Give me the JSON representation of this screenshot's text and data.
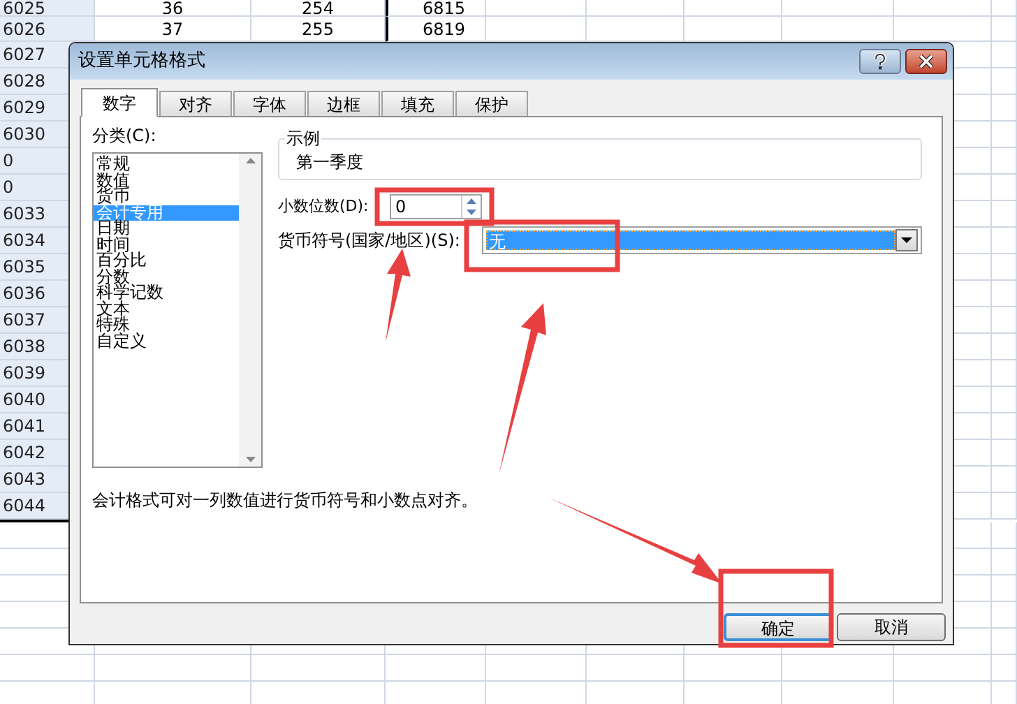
{
  "sheet": {
    "rows": [
      {
        "header": "6025",
        "cells": [
          "36",
          "254",
          "6815"
        ]
      },
      {
        "header": "6026",
        "cells": [
          "37",
          "255",
          "6819"
        ]
      },
      {
        "header": "6027"
      },
      {
        "header": "6028"
      },
      {
        "header": "6029"
      },
      {
        "header": "6030"
      },
      {
        "header": "0"
      },
      {
        "header": "0"
      },
      {
        "header": "6033"
      },
      {
        "header": "6034"
      },
      {
        "header": "6035"
      },
      {
        "header": "6036"
      },
      {
        "header": "6037"
      },
      {
        "header": "6038"
      },
      {
        "header": "6039"
      },
      {
        "header": "6040"
      },
      {
        "header": "6041"
      },
      {
        "header": "6042"
      },
      {
        "header": "6043"
      },
      {
        "header": "6044"
      }
    ]
  },
  "dialog": {
    "title": "设置单元格格式",
    "tabs": [
      {
        "label": "数字",
        "selected": true
      },
      {
        "label": "对齐",
        "selected": false
      },
      {
        "label": "字体",
        "selected": false
      },
      {
        "label": "边框",
        "selected": false
      },
      {
        "label": "填充",
        "selected": false
      },
      {
        "label": "保护",
        "selected": false
      }
    ],
    "category_label": "分类(C):",
    "categories": [
      {
        "label": "常规",
        "selected": false
      },
      {
        "label": "数值",
        "selected": false
      },
      {
        "label": "货币",
        "selected": false
      },
      {
        "label": "会计专用",
        "selected": true
      },
      {
        "label": "日期",
        "selected": false
      },
      {
        "label": "时间",
        "selected": false
      },
      {
        "label": "百分比",
        "selected": false
      },
      {
        "label": "分数",
        "selected": false
      },
      {
        "label": "科学记数",
        "selected": false
      },
      {
        "label": "文本",
        "selected": false
      },
      {
        "label": "特殊",
        "selected": false
      },
      {
        "label": "自定义",
        "selected": false
      }
    ],
    "sample": {
      "legend": "示例",
      "value": "第一季度"
    },
    "decimal_places": {
      "label": "小数位数(D):",
      "value": "0"
    },
    "currency_symbol": {
      "label": "货币符号(国家/地区)(S):",
      "value": "无"
    },
    "description": "会计格式可对一列数值进行货币符号和小数点对齐。",
    "buttons": [
      {
        "label": "确定",
        "default": true
      },
      {
        "label": "取消",
        "default": false
      }
    ]
  }
}
